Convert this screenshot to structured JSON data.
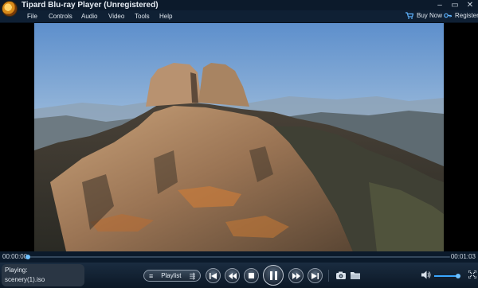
{
  "window": {
    "title": "Tipard Blu-ray Player (Unregistered)",
    "controls": {
      "minimize": "–",
      "restore": "▭",
      "close": "✕"
    }
  },
  "menu": {
    "items": [
      "File",
      "Controls",
      "Audio",
      "Video",
      "Tools",
      "Help"
    ],
    "buy_now": "Buy Now",
    "register": "Register"
  },
  "playback": {
    "current_time": "00:00:00",
    "total_time": "00:01:03",
    "progress_fraction": 0.0,
    "status_label": "Playing:",
    "file_name": "scenery(1).iso"
  },
  "controls": {
    "playlist_label": "Playlist",
    "volume_fraction": 0.9
  },
  "colors": {
    "accent": "#3aa7ff",
    "titlebar_bg": "#0c1a2b",
    "controlbar_bg": "#1a2c40"
  },
  "icons": {
    "app": "tipard-logo-icon",
    "buy": "cart-icon",
    "register": "key-icon",
    "prev": "previous-icon",
    "rewind": "rewind-icon",
    "stop": "stop-icon",
    "play_pause": "pause-icon",
    "forward": "fast-forward-icon",
    "next": "next-icon",
    "snapshot": "camera-icon",
    "folder": "folder-icon",
    "volume": "speaker-icon",
    "fullscreen": "fullscreen-icon"
  }
}
